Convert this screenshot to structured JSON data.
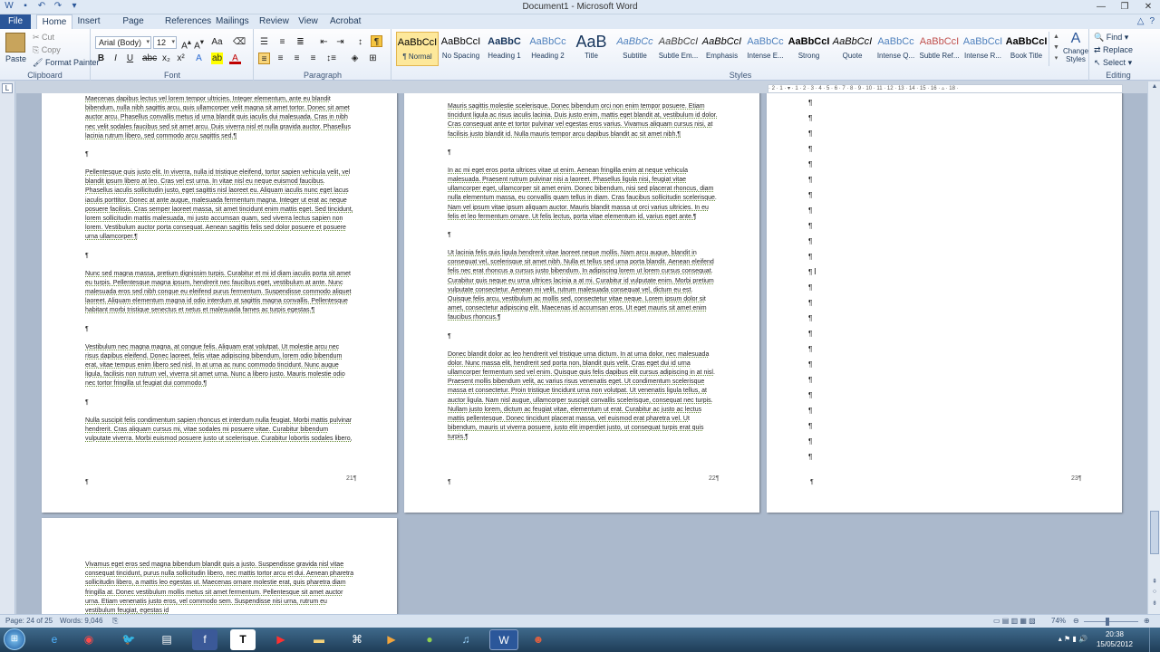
{
  "window": {
    "title": "Document1 - Microsoft Word"
  },
  "tabs": [
    "File",
    "Home",
    "Insert",
    "Page Layout",
    "References",
    "Mailings",
    "Review",
    "View",
    "Acrobat"
  ],
  "ribbon": {
    "clipboard": {
      "paste": "Paste",
      "cut": "Cut",
      "copy": "Copy",
      "format_painter": "Format Painter",
      "label": "Clipboard"
    },
    "font": {
      "name": "Arial (Body)",
      "size": "12",
      "label": "Font"
    },
    "paragraph": {
      "label": "Paragraph"
    },
    "styles": {
      "label": "Styles",
      "items": [
        {
          "sample": "AaBbCcI",
          "name": "¶ Normal"
        },
        {
          "sample": "AaBbCcI",
          "name": "No Spacing"
        },
        {
          "sample": "AaBbC",
          "name": "Heading 1"
        },
        {
          "sample": "AaBbCc",
          "name": "Heading 2"
        },
        {
          "sample": "AaB",
          "name": "Title"
        },
        {
          "sample": "AaBbCc",
          "name": "Subtitle"
        },
        {
          "sample": "AaBbCcI",
          "name": "Subtle Em..."
        },
        {
          "sample": "AaBbCcI",
          "name": "Emphasis"
        },
        {
          "sample": "AaBbCc",
          "name": "Intense E..."
        },
        {
          "sample": "AaBbCcI",
          "name": "Strong"
        },
        {
          "sample": "AaBbCcI",
          "name": "Quote"
        },
        {
          "sample": "AaBbCc",
          "name": "Intense Q..."
        },
        {
          "sample": "AaBbCcI",
          "name": "Subtle Ref..."
        },
        {
          "sample": "AaBbCcI",
          "name": "Intense R..."
        },
        {
          "sample": "AaBbCcI",
          "name": "Book Title"
        }
      ],
      "change_styles": "Change Styles"
    },
    "editing": {
      "find": "Find",
      "replace": "Replace",
      "select": "Select",
      "label": "Editing"
    }
  },
  "pages": {
    "p21": {
      "paragraphs": [
        "Maecenas dapibus lectus vel lorem tempor ultricies. Integer elementum, ante eu blandit bibendum, nulla nibh sagittis arcu, quis ullamcorper velit magna sit amet tortor. Donec sit amet auctor arcu. Phasellus convallis metus id urna blandit quis iaculis dui malesuada. Cras in nibh nec velit sodales faucibus sed sit amet arcu. Duis viverra nisl et nulla gravida auctor. Phasellus lacinia rutrum libero, sed commodo arcu sagittis sed.¶",
        "Pellentesque quis justo elit. In viverra, nulla id tristique eleifend, tortor sapien vehicula velit, vel blandit ipsum libero at leo. Cras vel est urna. In vitae nisl eu neque euismod faucibus. Phasellus iaculis sollicitudin justo, eget sagittis nisl laoreet eu. Aliquam iaculis nunc eget lacus iaculis porttitor. Donec at ante augue, malesuada fermentum magna. Integer ut erat ac neque posuere facilisis. Cras semper laoreet massa, sit amet tincidunt enim mattis eget. Sed tincidunt, lorem sollicitudin mattis malesuada, mi justo accumsan quam, sed viverra lectus sapien non lorem. Vestibulum auctor porta consequat. Aenean sagittis felis sed dolor posuere et posuere urna ullamcorper.¶",
        "Nunc sed magna massa, pretium dignissim turpis. Curabitur et mi id diam iaculis porta sit amet eu turpis. Pellentesque magna ipsum, hendrerit nec faucibus eget, vestibulum at ante. Nunc malesuada eros sed nibh congue eu eleifend purus fermentum. Suspendisse commodo aliquet laoreet. Aliquam elementum magna id odio interdum at sagittis magna convallis. Pellentesque habitant morbi tristique senectus et netus et malesuada fames ac turpis egestas.¶",
        "Vestibulum nec magna magna, at congue felis. Aliquam erat volutpat. Ut molestie arcu nec risus dapibus eleifend. Donec laoreet, felis vitae adipiscing bibendum, lorem odio bibendum erat, vitae tempus enim libero sed nisl. In at urna ac nunc commodo tincidunt. Nunc augue ligula, facilisis non rutrum vel, viverra sit amet urna. Nunc a libero justo. Mauris molestie odio nec tortor fringilla ut feugiat dui commodo.¶",
        "Nulla suscipit felis condimentum sapien rhoncus et interdum nulla feugiat. Morbi mattis pulvinar hendrerit. Cras aliquam cursus mi, vitae sodales mi posuere vitae. Curabitur bibendum vulputate viverra. Morbi euismod posuere justo ut scelerisque. Curabitur lobortis sodales libero, eu venenatis arcu semper nec. Maecenas fringilla"
      ],
      "number": "21¶"
    },
    "p22": {
      "paragraphs": [
        "Mauris sagittis molestie scelerisque. Donec bibendum orci non enim tempor posuere. Etiam tincidunt ligula ac risus iaculis lacinia. Duis justo enim, mattis eget blandit at, vestibulum id dolor. Cras consequat ante et tortor pulvinar vel egestas eros varius. Vivamus aliquam cursus nisi, at facilisis justo blandit id. Nulla mauris tempor arcu dapibus blandit ac sit amet nibh.¶",
        "In ac mi eget eros porta ultrices vitae ut enim. Aenean fringilla enim at neque vehicula malesuada. Praesent rutrum pulvinar nisi a laoreet. Phasellus ligula nisi, feugiat vitae ullamcorper eget, ullamcorper sit amet enim. Donec bibendum, nisi sed placerat rhoncus, diam nulla elementum massa, eu convallis quam tellus in diam. Cras faucibus sollicitudin scelerisque. Nam vel ipsum vitae ipsum aliquam auctor. Mauris blandit massa ut orci varius ultricies. In eu felis et leo fermentum ornare. Ut felis lectus, porta vitae elementum id, varius eget ante.¶",
        "Ut lacinia felis quis ligula hendrerit vitae laoreet neque mollis. Nam arcu augue, blandit in consequat vel, scelerisque sit amet nibh. Nulla et tellus sed urna porta blandit. Aenean eleifend felis nec erat rhoncus a cursus justo bibendum. In adipiscing lorem ut lorem cursus consequat. Curabitur quis neque eu urna ultrices lacinia a at mi. Curabitur id vulputate enim. Morbi pretium vulputate consectetur. Aenean mi velit, rutrum malesuada consequat vel, dictum eu est. Quisque felis arcu, vestibulum ac mollis sed, consectetur vitae neque. Lorem ipsum dolor sit amet, consectetur adipiscing elit. Maecenas id accumsan eros. Ut eget mauris sit amet enim faucibus rhoncus.¶",
        "Donec blandit dolor ac leo hendrerit vel tristique urna dictum. In at urna dolor, nec malesuada dolor. Nunc massa elit, hendrerit sed porta non, blandit quis velit. Cras eget dui id urna ullamcorper fermentum sed vel enim. Quisque quis felis dapibus elit cursus adipiscing in at nisl. Praesent mollis bibendum velit, ac varius risus venenatis eget. Ut condimentum scelerisque massa et consectetur. Proin tristique tincidunt urna non volutpat. Ut venenatis ligula tellus, at auctor ligula. Nam nisl augue, ullamcorper suscipit convallis scelerisque, consequat nec turpis. Nullam justo lorem, dictum ac feugiat vitae, elementum ut erat. Curabitur ac justo ac lectus mattis pellentesque. Donec tincidunt placerat massa, vel euismod erat pharetra vel. Ut bibendum, mauris ut viverra posuere, justo elit imperdiet justo, ut consequat turpis erat quis turpis.¶"
      ],
      "number": "22¶"
    },
    "p23": {
      "number": "23¶",
      "pilcrows": 24
    },
    "p24": {
      "paragraphs": [
        "Vivamus eget eros sed magna bibendum blandit quis a justo. Suspendisse gravida nisl vitae consequat tincidunt, purus nulla sollicitudin libero, nec mattis tortor arcu et dui. Aenean pharetra sollicitudin libero, a mattis leo egestas ut. Maecenas ornare molestie erat, quis pharetra diam fringilla at. Donec vestibulum mollis metus sit amet fermentum. Pellentesque sit amet auctor urna. Etiam venenatis justo eros, vel commodo sem. Suspendisse nisi urna, rutrum eu vestibulum feugiat, egestas id"
      ]
    }
  },
  "status": {
    "page": "Page: 24 of 25",
    "words": "Words: 9,046",
    "zoom": "74%"
  },
  "taskbar": {
    "time": "20:38",
    "date": "15/05/2012"
  }
}
